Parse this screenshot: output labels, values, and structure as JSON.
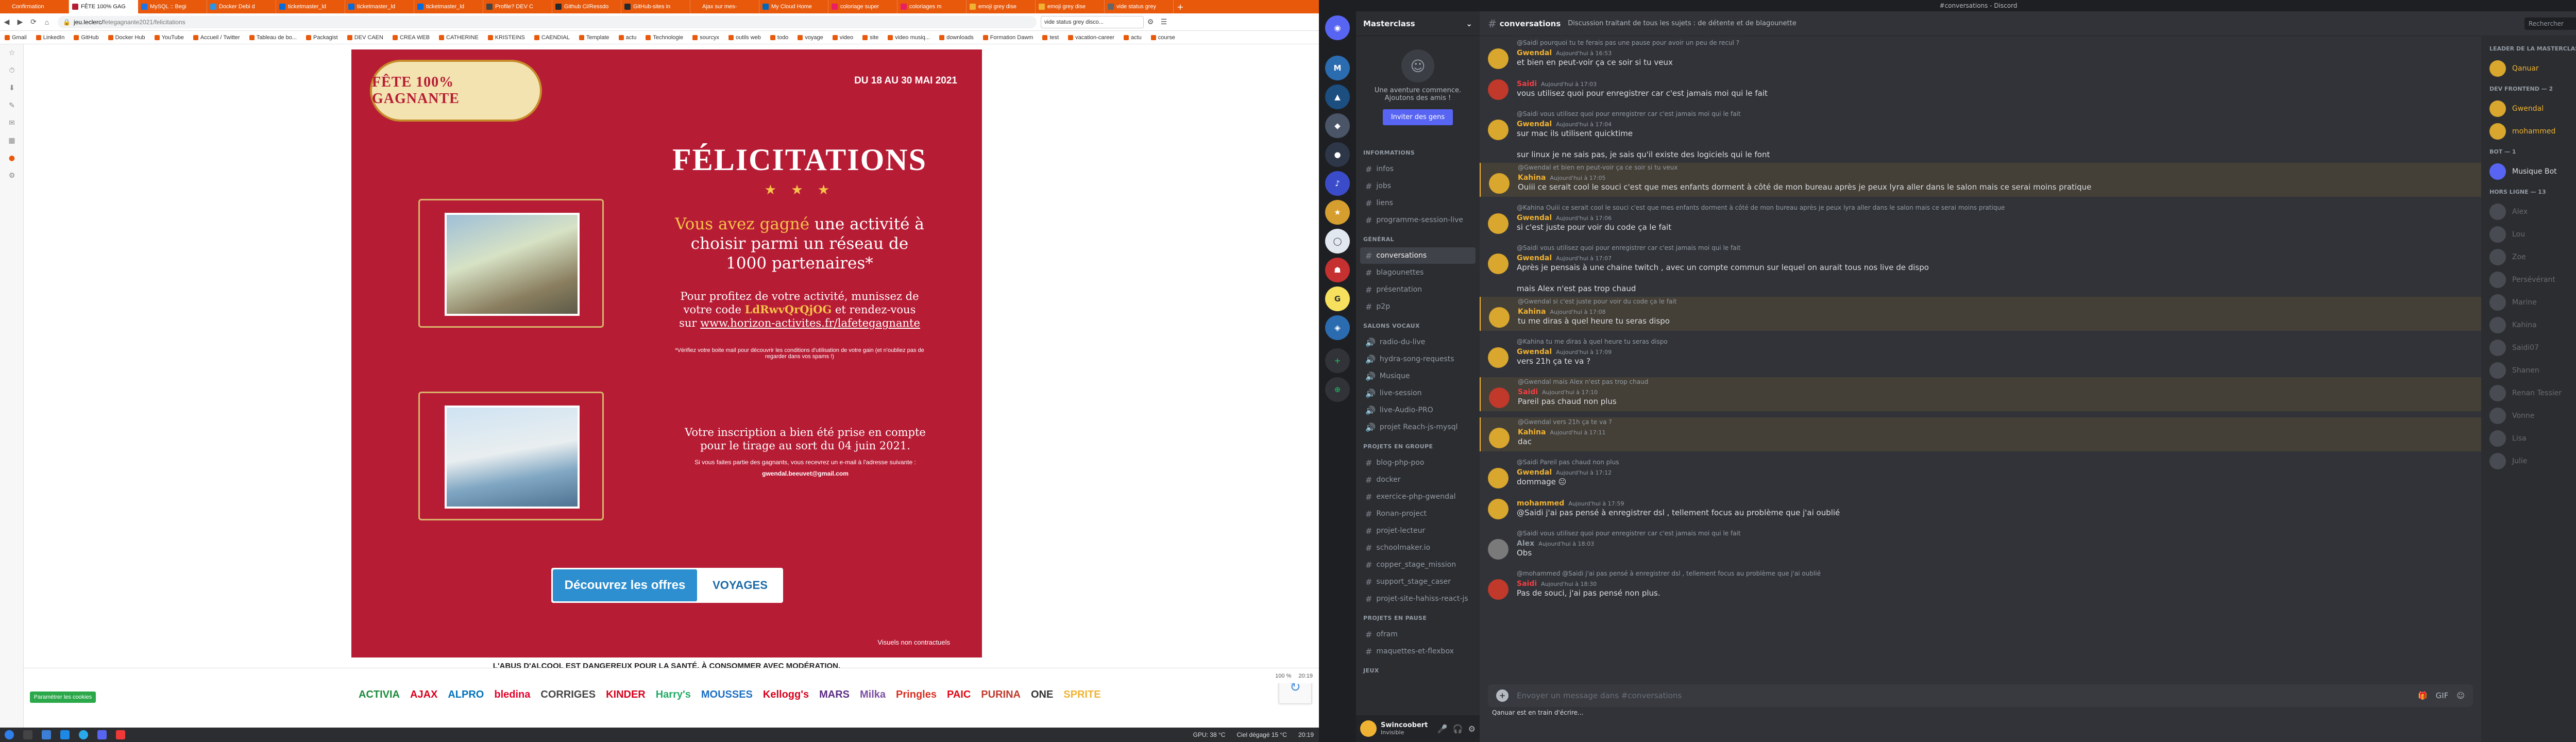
{
  "browser": {
    "tabs": [
      {
        "label": "Confirmation",
        "color": "#e8590c"
      },
      {
        "label": "FÊTE 100% GAG",
        "color": "#b71c35",
        "active": true
      },
      {
        "label": "MySQL :: Begi",
        "color": "#1a73e8"
      },
      {
        "label": "Docker Debi d",
        "color": "#2496ed"
      },
      {
        "label": "ticketmaster_ld",
        "color": "#026cdf"
      },
      {
        "label": "ticketmaster_ld",
        "color": "#026cdf"
      },
      {
        "label": "ticketmaster_ld",
        "color": "#026cdf"
      },
      {
        "label": "Profile? DEV C",
        "color": "#444"
      },
      {
        "label": "Github Cl/Ressdo",
        "color": "#24292e"
      },
      {
        "label": "GitHub-sites in",
        "color": "#24292e"
      },
      {
        "label": "Ajax sur mes-",
        "color": "#e8590c"
      },
      {
        "label": "My Cloud Home",
        "color": "#0067b8"
      },
      {
        "label": "coloriage super",
        "color": "#e91e63"
      },
      {
        "label": "coloriages m",
        "color": "#e91e63"
      },
      {
        "label": "emoji grey dise",
        "color": "#f0b232"
      },
      {
        "label": "emoji grey dise",
        "color": "#f0b232"
      },
      {
        "label": "vide status grey",
        "color": "#666"
      }
    ],
    "url_host": "jeu.leclerc/",
    "url_path": "fetegagnante2021/felicitations",
    "search_text": "vide status grey disco...",
    "bookmarks": [
      "Gmail",
      "LinkedIn",
      "GitHub",
      "Docker Hub",
      "YouTube",
      "Accueil / Twitter",
      "Tableau de bo...",
      "Packagist",
      "DEV CAEN",
      "CREA WEB",
      "CATHERINE",
      "KRISTEINS",
      "CAENDIAL",
      "Template",
      "actu",
      "Technologie",
      "sourcyx",
      "outils web",
      "todo",
      "voyage",
      "video",
      "site",
      "video musiq...",
      "downloads",
      "Formation Dawm",
      "test",
      "vacation-career",
      "actu",
      "course"
    ],
    "promo": {
      "dates": "DU 18 AU 30 MAI 2021",
      "logo_text": "FÊTE 100% GAGNANTE",
      "title": "FÉLICITATIONS",
      "stars": "★ ★ ★",
      "win_hl": "Vous avez gagné",
      "win_rest": " une activité à choisir parmi un réseau de 1000 partenaires*",
      "howto_1": "Pour profitez de votre activité, munissez de votre code ",
      "code": "LdRwvQrQjOG",
      "howto_2": " et rendez-vous sur ",
      "link": "www.horizon-activites.fr/lafetegagnante",
      "fine": "*Vérifiez votre boite mail pour découvrir les conditions d'utilisation de votre gain (et n'oubliez pas de regarder dans vos spams !)",
      "confirm": "Votre inscription a bien été prise en compte pour le tirage au sort du 04 juin 2021.",
      "notify": "Si vous faites partie des gagnants, vous recevrez un e-mail à l'adresse suivante :",
      "email": "gwendal.beeuvet@gmail.com",
      "offers_label": "Découvrez les offres",
      "offers_brand": "VOYAGES",
      "visuals": "Visuels non contractuels",
      "alcohol": "L'ABUS D'ALCOOL EST DANGEREUX POUR LA SANTÉ. À CONSOMMER AVEC MODÉRATION.",
      "partners": [
        "ACTIVIA",
        "AJAX",
        "ALPRO",
        "bledina",
        "CORRIGES",
        "KINDER",
        "Harry's",
        "MOUSSES",
        "Kellogg's",
        "MARS",
        "Milka",
        "Pringles",
        "PAIC",
        "PURINA",
        "ONE",
        "SPRITE"
      ],
      "pref_button": "Paramétrer les cookies"
    },
    "statusbar": {
      "zoom": "100 %",
      "time": "20:19"
    }
  },
  "taskbar": {
    "weather": "Ciel dégagé 15 °C",
    "cpu": "GPU: 38 °C",
    "clock": "20:19"
  },
  "discord": {
    "window_title": "#conversations - Discord",
    "server_name": "Masterclass",
    "invite_title": "Une aventure commence. Ajoutons des amis !",
    "invite_button": "Inviter des gens",
    "categories": [
      "INFORMATIONS",
      "GÉNÉRAL",
      "SALONS VOCAUX",
      "PROJETS EN GROUPE",
      "PROJETS EN PAUSE",
      "JEUX"
    ],
    "channels_info": [
      "infos",
      "jobs",
      "liens",
      "programme-session-live"
    ],
    "channels_general": [
      "conversations",
      "blagounettes",
      "présentation",
      "p2p"
    ],
    "channels_voice": [
      "radio-du-live",
      "hydra-song-requests",
      "Musique",
      "live-session",
      "live-Audio-PRO",
      "projet Reach-js-mysql"
    ],
    "channels_projects": [
      "blog-php-poo",
      "docker",
      "exercice-php-gwendal",
      "Ronan-project",
      "projet-lecteur",
      "schoolmaker.io",
      "copper_stage_mission",
      "support_stage_caser",
      "projet-site-hahiss-react-js"
    ],
    "channels_paused": [
      "ofram",
      "maquettes-et-flexbox"
    ],
    "user": {
      "name": "Swincoobert",
      "status": "Invisible"
    },
    "channel_header": "conversations",
    "topic": "Discussion traitant de tous les sujets : de détente et de blagounette",
    "search_placeholder": "Rechercher",
    "composer_placeholder": "Envoyer un message dans #conversations",
    "typing": "Qanuar est en train d'écrire...",
    "messages": [
      {
        "reply": "@Saidi pourquoi tu te ferais pas une pause pour avoir un peu de recul ?",
        "author": "Gwendal",
        "color": "#f0b232",
        "time": "Aujourd'hui à 16:53",
        "text": "et bien en peut-voir ça ce soir si tu veux",
        "hl": false
      },
      {
        "reply": "",
        "author": "Saidi",
        "color": "#f23f43",
        "time": "Aujourd'hui à 17:03",
        "text": "vous utilisez quoi pour enregistrer car c'est jamais moi qui le fait",
        "hl": false
      },
      {
        "reply": "@Saidi vous utilisez quoi pour enregistrer car c'est jamais moi qui le fait",
        "author": "Gwendal",
        "color": "#f0b232",
        "time": "Aujourd'hui à 17:04",
        "text": "sur mac ils utilisent quicktime",
        "hl": false
      },
      {
        "reply": "",
        "author": "",
        "color": "#f0b232",
        "time": "",
        "text": "sur linux je ne sais pas, je sais qu'il existe des logiciels qui le font",
        "hl": false
      },
      {
        "reply": "@Gwendal et bien en peut-voir ça ce soir si tu veux",
        "author": "Kahina",
        "color": "#f0b232",
        "time": "Aujourd'hui à 17:05",
        "text": "Ouiii ce serait cool le souci c'est que mes enfants dorment à côté de mon bureau après je peux lyra aller dans le salon mais ce serai moins pratique",
        "hl": true
      },
      {
        "reply": "@Kahina Ouiii ce serait cool le souci c'est que mes enfants dorment à côté de mon bureau après je peux lyra aller dans le salon mais ce serai moins pratique",
        "author": "Gwendal",
        "color": "#f0b232",
        "time": "Aujourd'hui à 17:06",
        "text": "si c'est juste pour voir du code ça le fait",
        "hl": false
      },
      {
        "reply": "@Saidi vous utilisez quoi pour enregistrer car c'est jamais moi qui le fait",
        "author": "Gwendal",
        "color": "#f0b232",
        "time": "Aujourd'hui à 17:07",
        "text": "Après je pensais à une chaine twitch , avec un compte commun sur lequel on aurait tous nos live de dispo",
        "hl": false
      },
      {
        "reply": "",
        "author": "",
        "color": "#f0b232",
        "time": "",
        "text": "mais Alex n'est pas trop chaud",
        "hl": false
      },
      {
        "reply": "@Gwendal si c'est juste pour voir du code ça le fait",
        "author": "Kahina",
        "color": "#f0b232",
        "time": "Aujourd'hui à 17:08",
        "text": "tu me diras à quel heure tu seras dispo",
        "hl": true
      },
      {
        "reply": "@Kahina tu me diras à quel heure tu seras dispo",
        "author": "Gwendal",
        "color": "#f0b232",
        "time": "Aujourd'hui à 17:09",
        "text": "vers 21h ça te va ?",
        "hl": false
      },
      {
        "reply": "@Gwendal mais Alex n'est pas trop chaud",
        "author": "Saidi",
        "color": "#f23f43",
        "time": "Aujourd'hui à 17:10",
        "text": "Pareil pas chaud non plus",
        "hl": true
      },
      {
        "reply": "@Gwendal vers 21h ça te va ?",
        "author": "Kahina",
        "color": "#f0b232",
        "time": "Aujourd'hui à 17:11",
        "text": "dac",
        "hl": true
      },
      {
        "reply": "@Saidi Pareil pas chaud non plus",
        "author": "Gwendal",
        "color": "#f0b232",
        "time": "Aujourd'hui à 17:12",
        "text": "dommage 😐",
        "hl": false
      },
      {
        "reply": "",
        "author": "mohammed",
        "color": "#f0b232",
        "time": "Aujourd'hui à 17:59",
        "text": "@Saidi j'ai pas pensé à enregistrer dsl , tellement focus au problème que j'ai oublié",
        "hl": false
      },
      {
        "reply": "@Saidi vous utilisez quoi pour enregistrer car c'est jamais moi qui le fait",
        "author": "Alex",
        "color": "#949ba4",
        "time": "Aujourd'hui à 18:03",
        "text": "Obs",
        "hl": false
      },
      {
        "reply": "@mohammed @Saidi j'ai pas pensé à enregistrer dsl , tellement focus au problème que j'ai oublié",
        "author": "Saidi",
        "color": "#f23f43",
        "time": "Aujourd'hui à 18:30",
        "text": "Pas de souci, j'ai pas pensé non plus.",
        "hl": false
      }
    ],
    "members": {
      "cat1": "LEADER DE LA MASTERCLASS — 1",
      "cat2": "DEV FRONTEND — 2",
      "cat3": "BOT — 1",
      "cat4": "HORS LIGNE — 13",
      "online": [
        {
          "name": "Qanuar",
          "color": "#f0b232"
        },
        {
          "name": "Gwendal",
          "color": "#f0b232"
        },
        {
          "name": "mohammed",
          "color": "#f0b232"
        },
        {
          "name": "Musique Bot",
          "color": "#dbdee1"
        }
      ],
      "offline": [
        "Alex",
        "Lou",
        "Zoe",
        "Persévérant",
        "Marine",
        "Kahina",
        "Saidi07",
        "Shanen",
        "Renan Tessier",
        "Vonne",
        "Lisa",
        "Julie"
      ]
    }
  }
}
